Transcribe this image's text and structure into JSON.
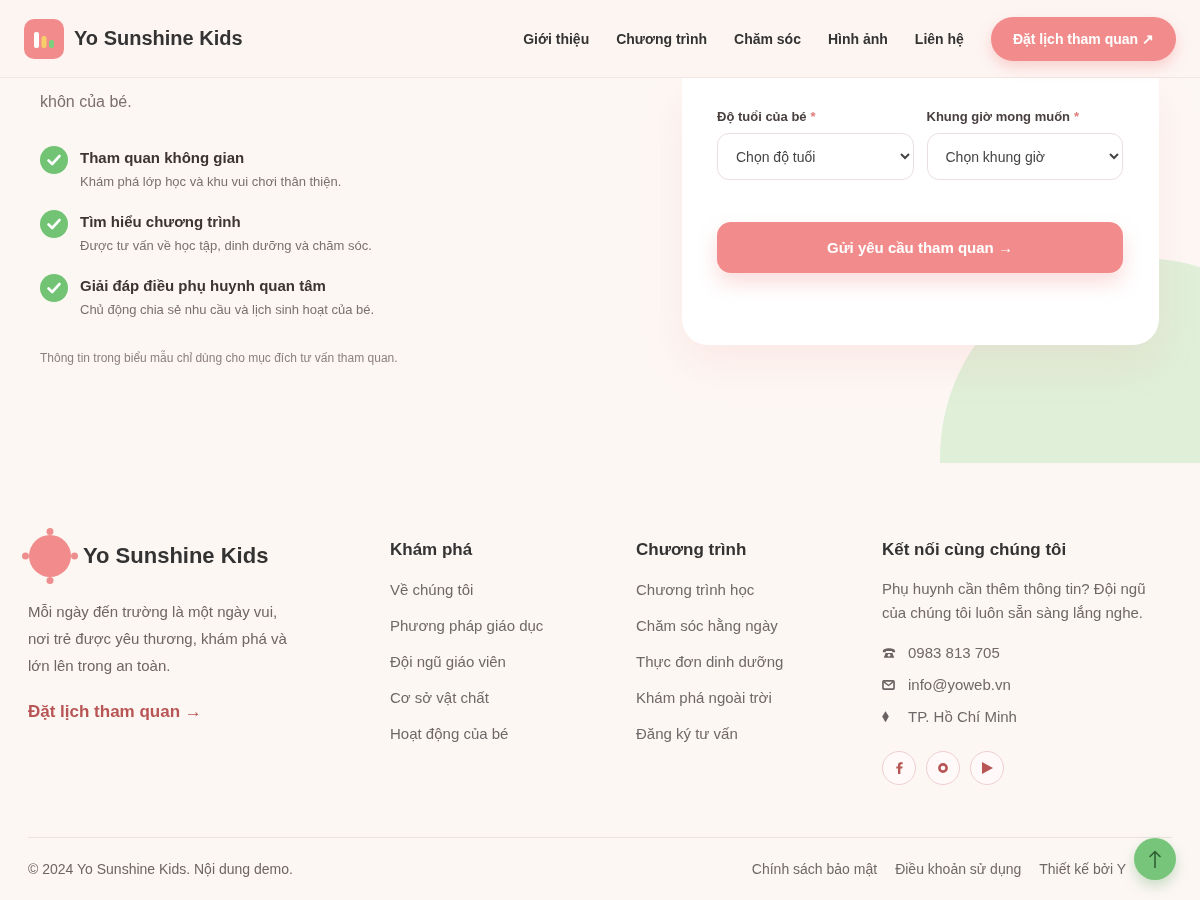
{
  "header": {
    "brand": "Yo Sunshine Kids",
    "nav": [
      "Giới thiệu",
      "Chương trình",
      "Chăm sóc",
      "Hình ảnh",
      "Liên hệ"
    ],
    "cta": "Đặt lịch tham quan ↗"
  },
  "visit": {
    "intro_tail": "khôn của bé.",
    "benefits": [
      {
        "title": "Tham quan không gian",
        "desc": "Khám phá lớp học và khu vui chơi thân thiện."
      },
      {
        "title": "Tìm hiểu chương trình",
        "desc": "Được tư vấn về học tập, dinh dưỡng và chăm sóc."
      },
      {
        "title": "Giải đáp điều phụ huynh quan tâm",
        "desc": "Chủ động chia sẻ nhu cầu và lịch sinh hoạt của bé."
      }
    ],
    "note": "Thông tin trong biểu mẫu chỉ dùng cho mục đích tư vấn tham quan."
  },
  "form": {
    "fields": [
      {
        "label": "Độ tuổi của bé",
        "required_mark": "*",
        "placeholder": "Chọn độ tuổi"
      },
      {
        "label": "Khung giờ mong muốn",
        "required_mark": "*",
        "placeholder": "Chọn khung giờ"
      }
    ],
    "submit": "Gửi yêu cầu tham quan →"
  },
  "footer": {
    "brand": "Yo Sunshine Kids",
    "description": "Mỗi ngày đến trường là một ngày vui, nơi trẻ được yêu thương, khám phá và lớn lên trong an toàn.",
    "cta": "Đặt lịch tham quan →",
    "columns": [
      {
        "title": "Khám phá",
        "links": [
          "Về chúng tôi",
          "Phương pháp giáo dục",
          "Đội ngũ giáo viên",
          "Cơ sở vật chất",
          "Hoạt động của bé"
        ]
      },
      {
        "title": "Chương trình",
        "links": [
          "Chương trình học",
          "Chăm sóc hằng ngày",
          "Thực đơn dinh dưỡng",
          "Khám phá ngoài trời",
          "Đăng ký tư vấn"
        ]
      }
    ],
    "contact": {
      "title": "Kết nối cùng chúng tôi",
      "text": "Phụ huynh cần thêm thông tin? Đội ngũ của chúng tôi luôn sẵn sàng lắng nghe.",
      "items": [
        {
          "kind": "phone",
          "text": "0983 813 705"
        },
        {
          "kind": "email",
          "text": "info@yoweb.vn"
        },
        {
          "kind": "location",
          "text": "TP. Hồ Chí Minh"
        }
      ],
      "socials": [
        {
          "kind": "facebook"
        },
        {
          "kind": "instagram"
        },
        {
          "kind": "youtube"
        }
      ]
    },
    "copyright": "© 2024 Yo Sunshine Kids. Nội dung demo.",
    "legal_links": [
      "Chính sách bảo mật",
      "Điều khoản sử dụng",
      "Thiết kế bởi Y"
    ]
  }
}
